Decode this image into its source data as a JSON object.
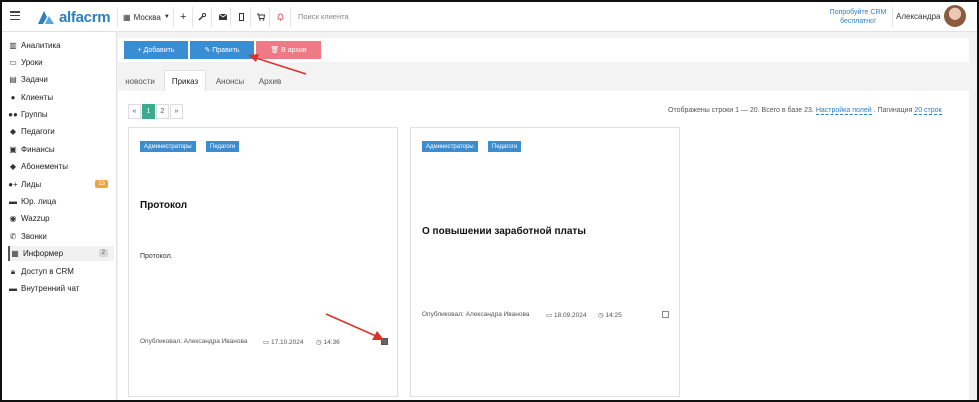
{
  "topbar": {
    "logo": "alfacrm",
    "branch": "Москва",
    "search_placeholder": "Поиск клиента",
    "promo": "Попробуйте CRM бесплатно!",
    "user": "Александра",
    "icons": [
      "plus-icon",
      "wrench-icon",
      "mail-icon",
      "phone-icon",
      "cart-icon",
      "bell-icon"
    ]
  },
  "sidebar": {
    "items": [
      {
        "label": "Аналитика",
        "icon": "chart-icon"
      },
      {
        "label": "Уроки",
        "icon": "calendar-icon"
      },
      {
        "label": "Задачи",
        "icon": "tasks-icon"
      },
      {
        "label": "Клиенты",
        "icon": "user-icon"
      },
      {
        "label": "Группы",
        "icon": "users-icon"
      },
      {
        "label": "Педагоги",
        "icon": "graduation-icon"
      },
      {
        "label": "Финансы",
        "icon": "money-icon"
      },
      {
        "label": "Абонементы",
        "icon": "tag-icon"
      },
      {
        "label": "Лиды",
        "icon": "user-plus-icon",
        "badge": "13"
      },
      {
        "label": "Юр. лица",
        "icon": "briefcase-icon"
      },
      {
        "label": "Wazzup",
        "icon": "whatsapp-icon"
      },
      {
        "label": "Звонки",
        "icon": "phone-icon"
      },
      {
        "label": "Информер",
        "icon": "newspaper-icon",
        "badge": "2"
      },
      {
        "label": "Доступ в CRM",
        "icon": "lock-icon"
      },
      {
        "label": "Внутренний чат",
        "icon": "chat-icon"
      }
    ]
  },
  "toolbar": {
    "add": "+ Добавить",
    "edit": "✎ Править",
    "archive": "🗑 В архив"
  },
  "tabs": [
    "новости",
    "Приказ",
    "Анонсы",
    "Архив"
  ],
  "pager": {
    "prev": "«",
    "pages": [
      "1",
      "2"
    ],
    "next": "»"
  },
  "info": {
    "shown": "Отображены строки 1 — 20. Всего в базе 23.",
    "settings": "Настройка полей",
    "pagination": ". Пагинация",
    "per_page": "20 строк"
  },
  "cards": [
    {
      "tags": [
        "Администраторы",
        "Педагоги"
      ],
      "title": "Протокол",
      "text": "Протокол.",
      "author": "Опубликовал: Александра Иванова",
      "date": "17.10.2024",
      "time": "14:36",
      "checked": true
    },
    {
      "tags": [
        "Администраторы",
        "Педагоги"
      ],
      "title": "О повышении заработной платы",
      "text": "",
      "author": "Опубликовал: Александра Иванова",
      "date": "18.09.2024",
      "time": "14:25",
      "checked": false
    }
  ],
  "colors": {
    "primary": "#3a8dd0",
    "danger": "#ee7a86",
    "active_page": "#3aab8e",
    "annotation": "#d9342b"
  }
}
